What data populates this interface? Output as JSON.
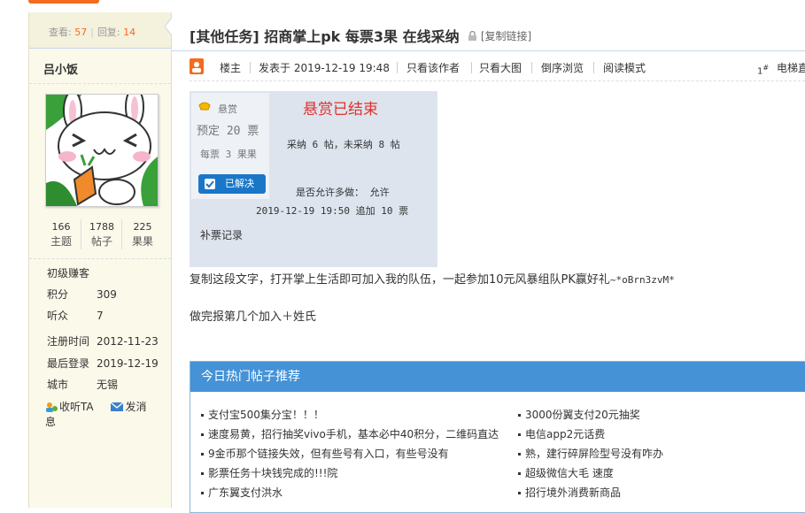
{
  "sidebar": {
    "views_label": "查看:",
    "views": "57",
    "replies_label": "回复:",
    "replies": "14",
    "username": "吕小饭",
    "counts": [
      {
        "value": "166",
        "label": "主题"
      },
      {
        "value": "1788",
        "label": "帖子"
      },
      {
        "value": "225",
        "label": "果果"
      }
    ],
    "level": "初级赚客",
    "points_label": "积分",
    "points": "309",
    "listeners_label": "听众",
    "listeners": "7",
    "reg_label": "注册时间",
    "reg_date": "2012-11-23",
    "last_label": "最后登录",
    "last_date": "2019-12-19",
    "city_label": "城市",
    "city": "无锡",
    "follow": "收听TA",
    "message": "发消息"
  },
  "thread": {
    "title": "[其他任务] 招商掌上pk 每票3果 在线采纳",
    "copy_link": "[复制链接]"
  },
  "post_meta": {
    "owner": "楼主",
    "posted": "发表于 2019-12-19 19:48",
    "only_author": "只看该作者",
    "only_images": "只看大图",
    "reverse": "倒序浏览",
    "read_mode": "阅读模式",
    "floor_num": "1",
    "floor_sup": "#",
    "elevator": "电梯直"
  },
  "bounty": {
    "tag": "悬赏",
    "reserved": "预定 20 票",
    "per_vote": "每票 3 果果",
    "resolved": "已解决",
    "ended": "悬赏已结束",
    "adopted": "采纳 6 帖，未采纳 8 帖",
    "allow_multi": "是否允许多做： 允许",
    "add_log": "2019-12-19 19:50 追加 10 票",
    "supplement": "补票记录"
  },
  "content": {
    "line1": "复制这段文字，打开掌上生活即可加入我的队伍，一起参加10元风暴组队PK赢好礼",
    "code": "~*oBrn3zvM*",
    "line2": "做完报第几个加入＋姓氏"
  },
  "hot": {
    "title": "今日热门帖子推荐",
    "left": [
      "支付宝500集分宝！！！",
      "速度易黄，招行抽奖vivo手机，基本必中40积分，二维码直达",
      "9金币那个链接失效，但有些号有入口，有些号没有",
      "影票任务十块钱完成的!!!院",
      "广东翼支付洪水"
    ],
    "right": [
      "3000份翼支付20元抽奖",
      "电信app2元话费",
      "熟，建行碎屏险型号没有咋办",
      "超级微信大毛 速度",
      "招行境外消费新商品"
    ]
  },
  "colors": {
    "accent": "#f26c1f",
    "link_blue": "#4592d6",
    "red": "#e0302a"
  }
}
